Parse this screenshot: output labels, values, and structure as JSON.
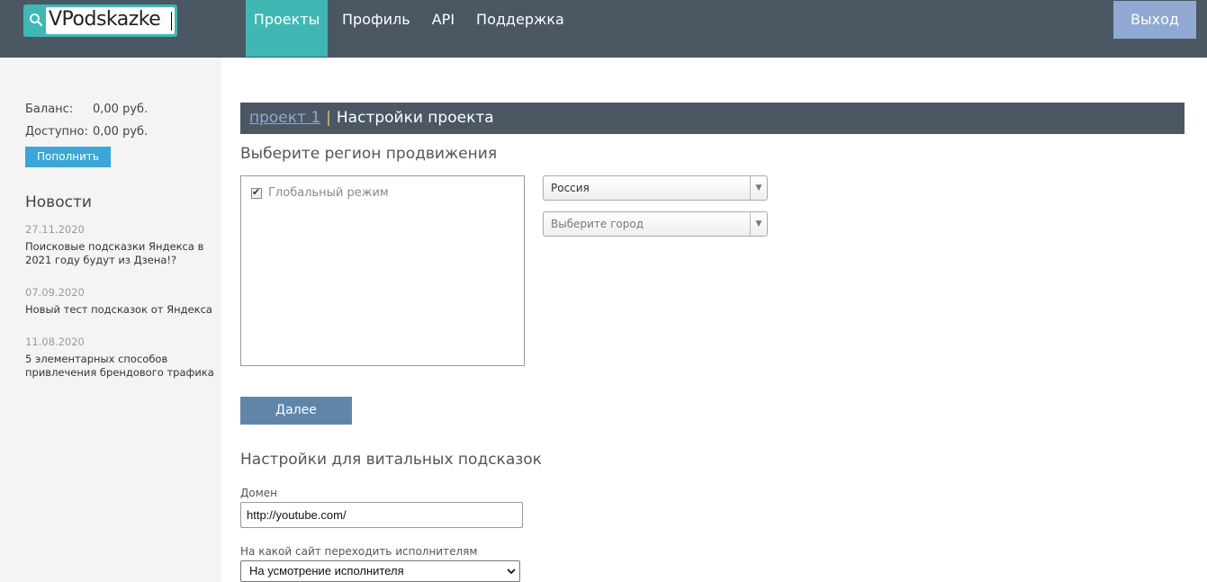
{
  "header": {
    "logo_text": "VPodskazke",
    "nav": [
      "Проекты",
      "Профиль",
      "API",
      "Поддержка"
    ],
    "logout_label": "Выход"
  },
  "sidebar": {
    "balance_label": "Баланс:",
    "balance_value": "0,00 руб.",
    "available_label": "Доступно:",
    "available_value": "0,00 руб.",
    "topup_label": "Пополнить",
    "news_title": "Новости",
    "news": [
      {
        "date": "27.11.2020",
        "text": "Поисковые подсказки Яндекса в 2021 году будут из Дзена!?"
      },
      {
        "date": "07.09.2020",
        "text": "Новый тест подсказок от Яндекса"
      },
      {
        "date": "11.08.2020",
        "text": "5 элементарных способов привлечения брендового трафика"
      }
    ]
  },
  "main": {
    "breadcrumb_link": "проект 1",
    "breadcrumb_sep": "|",
    "breadcrumb_current": "Настройки проекта",
    "region_title": "Выберите регион продвижения",
    "global_mode_label": "Глобальный режим",
    "country_value": "Россия",
    "city_placeholder": "Выберите город",
    "next_label": "Далее",
    "vital_title": "Настройки для витальных подсказок",
    "domain_label": "Домен",
    "domain_value": "http://youtube.com/",
    "site_label": "На какой сайт переходить исполнителям",
    "site_value": "На усмотрение исполнителя"
  },
  "colors": {
    "header_bg": "#4b5762",
    "accent_teal": "#3fb8b4",
    "logout_bg": "#8fa9d2",
    "topup_bg": "#3aa7d8",
    "next_bg": "#5f86a9"
  }
}
